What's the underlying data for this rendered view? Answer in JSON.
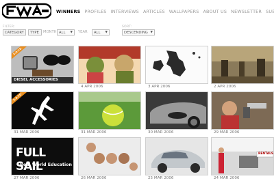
{
  "nav": {
    "items": [
      "WINNERS",
      "PROFILES",
      "INTERVIEWS",
      "ARTICLES",
      "WALLPAPERS",
      "ABOUT US",
      "NEWSLETTER",
      "SUBMIT"
    ]
  },
  "filters": {
    "filter_label": "FILTER:",
    "sort_label": "SORT:",
    "category": "CATEGORY",
    "type": "TYPE",
    "month_label": "MONTH",
    "month_value": "ALL",
    "year_label": "YEAR",
    "year_value": "ALL",
    "sort_value": "DESCENDING"
  },
  "cards": [
    {
      "date": "",
      "caption": "DIESEL ACCESSORIES",
      "badge": "S.O.T.D."
    },
    {
      "date": "4 APR 2006"
    },
    {
      "date": "3 APR 2006"
    },
    {
      "date": "2 APR 2006"
    },
    {
      "date": "31 MAR 2006",
      "badge": "S.O.T.D."
    },
    {
      "date": "31 MAR 2006"
    },
    {
      "date": "30 MAR 2006"
    },
    {
      "date": "29 MAR 2006"
    },
    {
      "date": "27 MAR 2006",
      "thumb_text_1": "FULL SAIL",
      "thumb_text_2": "Real World Education"
    },
    {
      "date": "26 MAR 2006"
    },
    {
      "date": "25 MAR 2006"
    },
    {
      "date": "24 MAR 2006",
      "thumb_text_1": "RENTALS"
    }
  ],
  "colors": {
    "accent": "#e98d1d"
  }
}
